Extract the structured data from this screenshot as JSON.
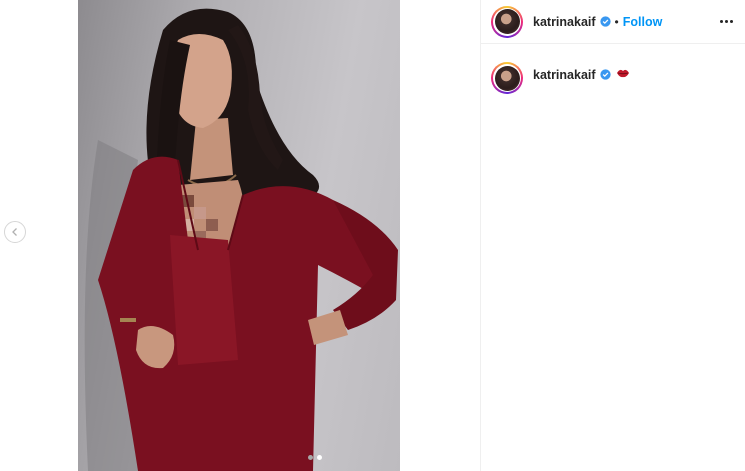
{
  "post": {
    "username": "katrinakaif",
    "separator": "•",
    "follow_label": "Follow",
    "caption_emoji": "lips-emoji",
    "carousel": {
      "total_slides": 2,
      "active_slide": 2
    }
  },
  "icons": {
    "prev": "chevron-left-icon",
    "verified": "verified-badge-icon",
    "more": "more-options-icon"
  },
  "colors": {
    "accent_blue": "#0095f6",
    "outfit_red": "#7a1020",
    "background": "#ffffff"
  }
}
